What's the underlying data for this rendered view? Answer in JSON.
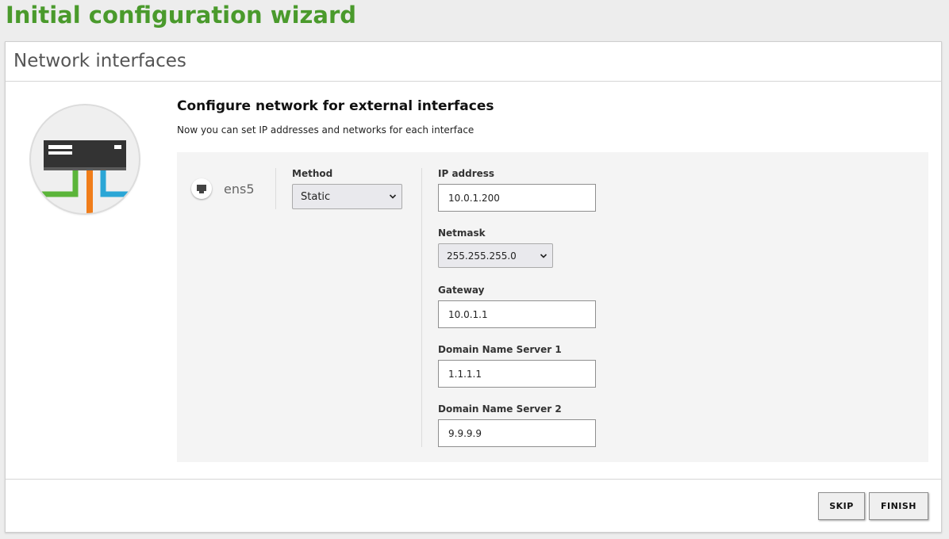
{
  "wizard": {
    "title": "Initial configuration wizard"
  },
  "panel": {
    "title": "Network interfaces"
  },
  "section": {
    "title": "Configure network for external interfaces",
    "description": "Now you can set IP addresses and networks for each interface"
  },
  "interface": {
    "name": "ens5",
    "icon": "ethernet-port-icon",
    "method_label": "Method",
    "method_value": "Static",
    "ip_label": "IP address",
    "ip_value": "10.0.1.200",
    "netmask_label": "Netmask",
    "netmask_value": "255.255.255.0",
    "gateway_label": "Gateway",
    "gateway_value": "10.0.1.1",
    "dns1_label": "Domain Name Server 1",
    "dns1_value": "1.1.1.1",
    "dns2_label": "Domain Name Server 2",
    "dns2_value": "9.9.9.9"
  },
  "buttons": {
    "skip": "SKIP",
    "finish": "FINISH"
  },
  "colors": {
    "title_green": "#4a9a2c",
    "cable_green": "#5bb53a",
    "cable_orange": "#f07d1a",
    "cable_blue": "#2ba6d6",
    "switch_body": "#333333"
  }
}
